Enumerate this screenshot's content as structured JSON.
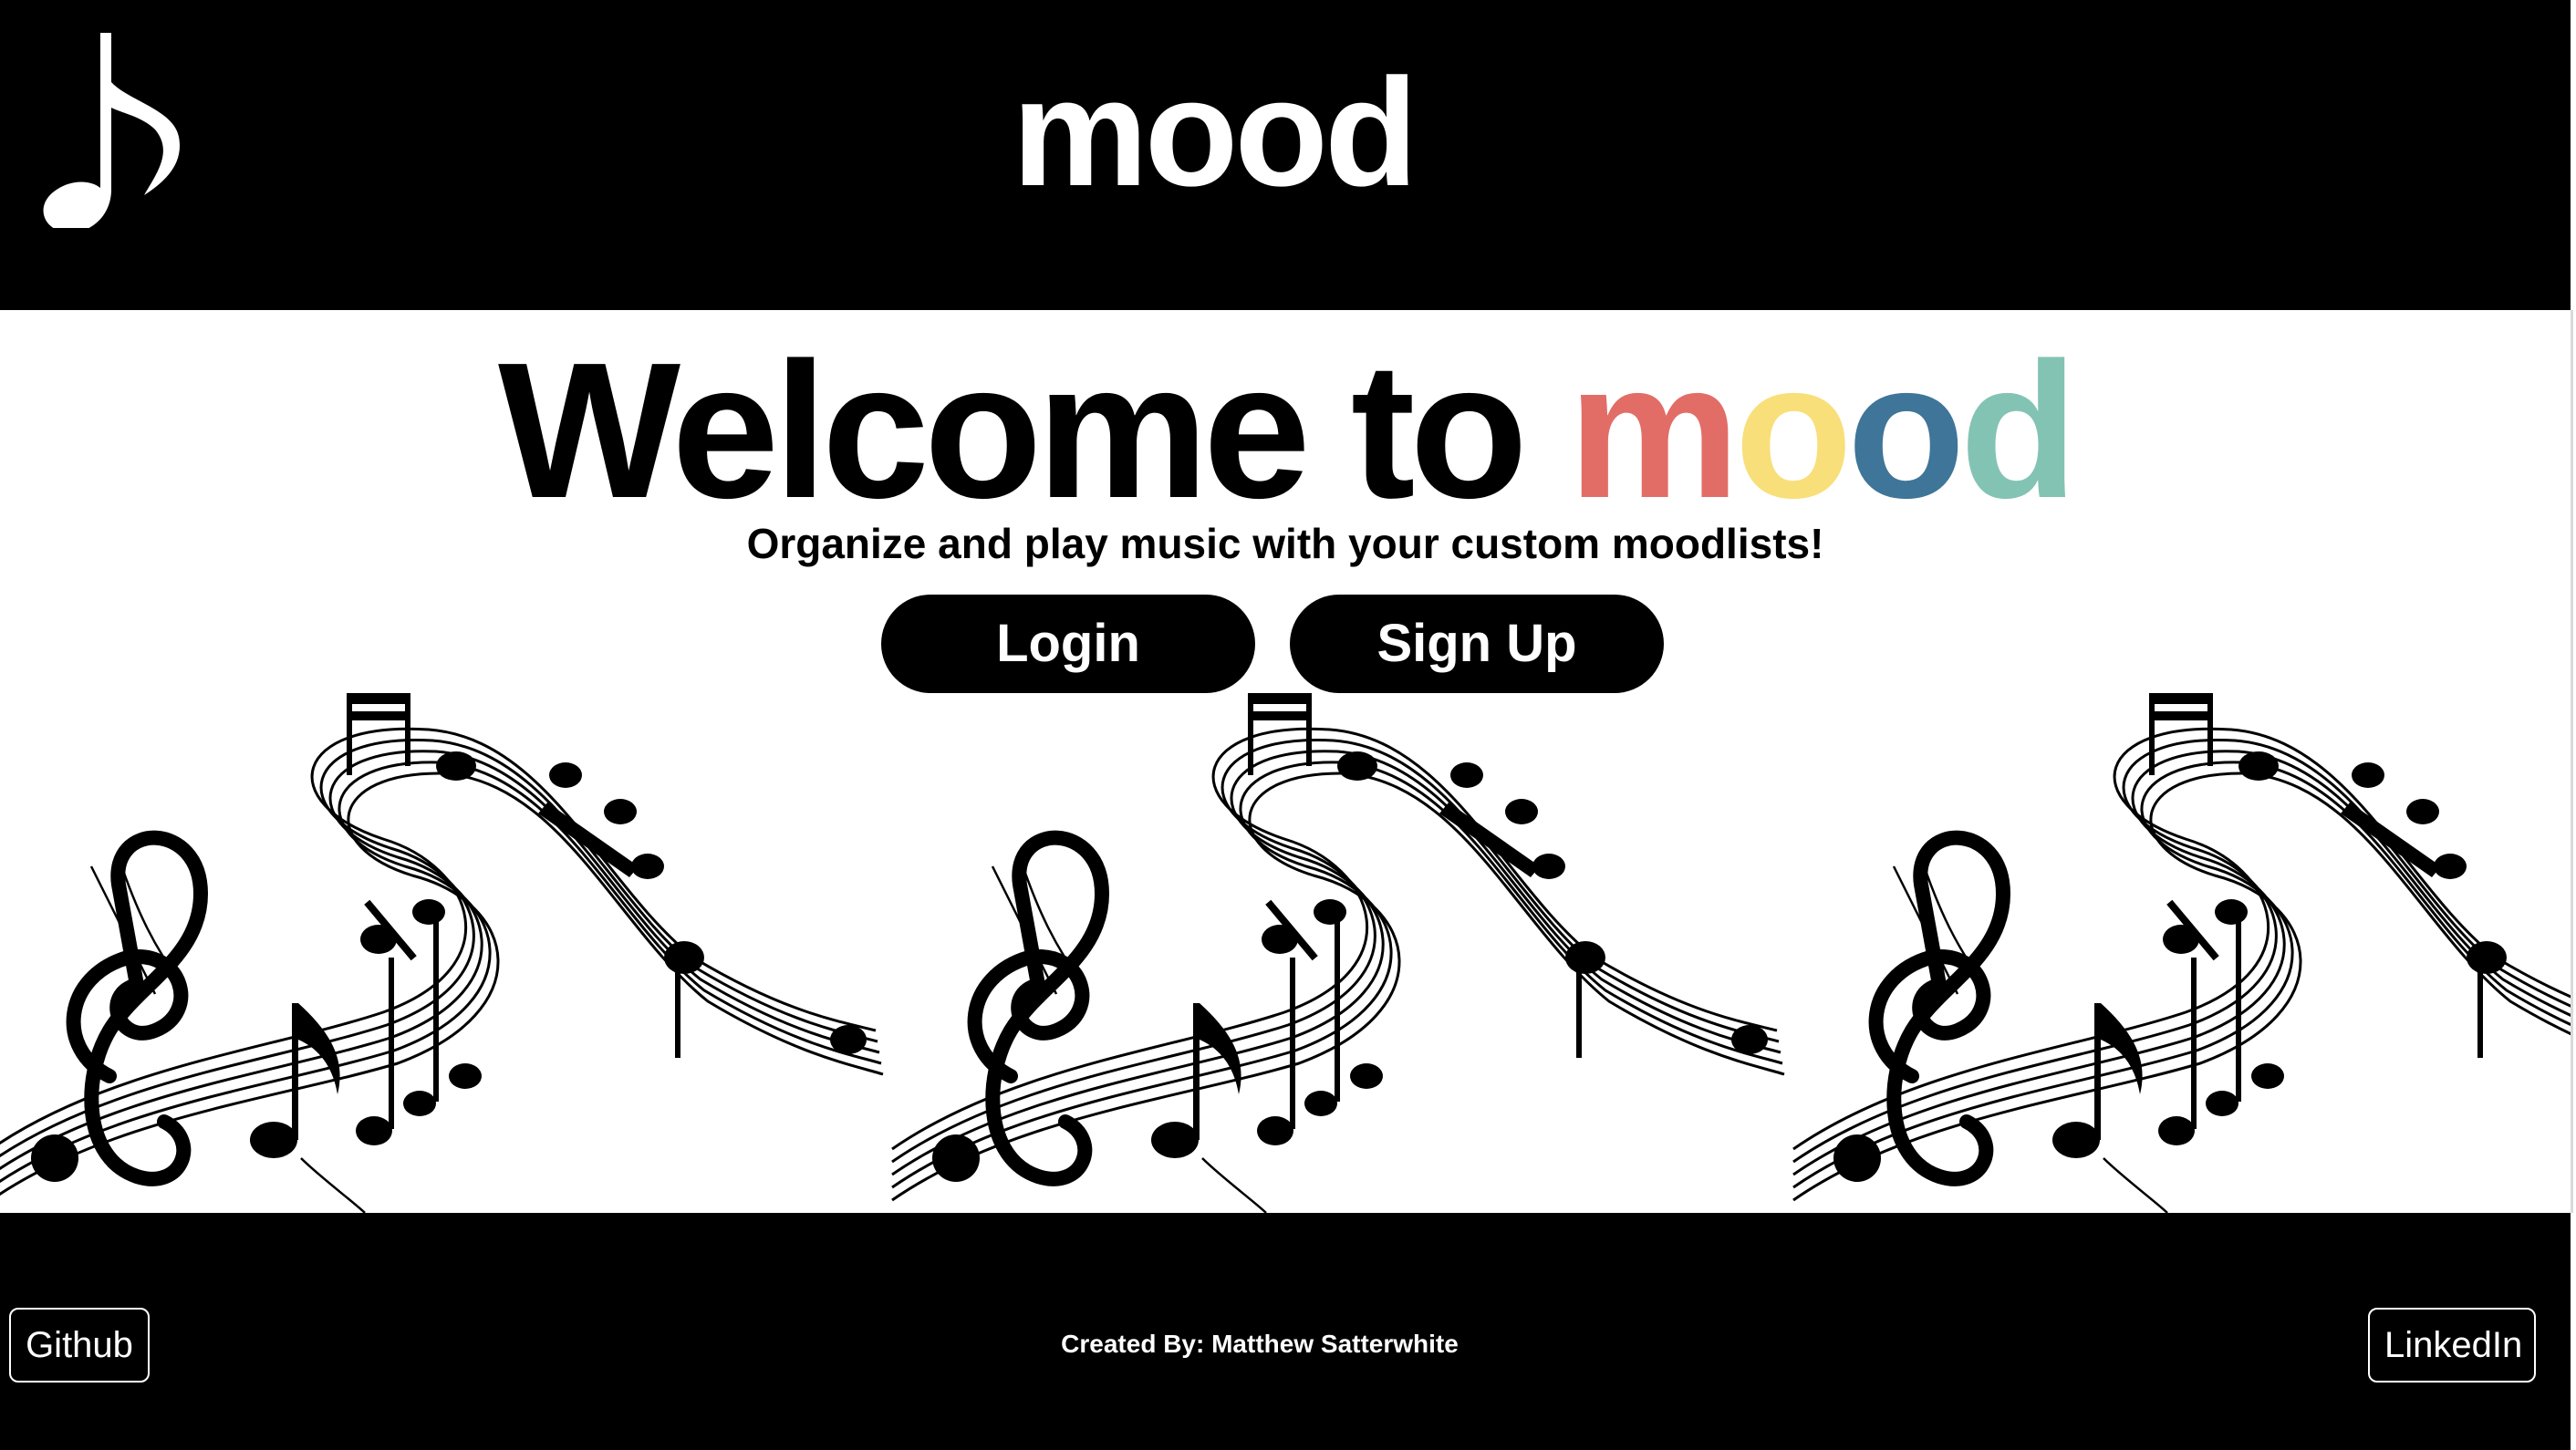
{
  "header": {
    "logo_icon": "music-note-icon",
    "title": "mood"
  },
  "hero": {
    "title_prefix_1": "Welcome",
    "title_prefix_2": "to",
    "title_letters": [
      {
        "char": "m",
        "color": "#E26D67"
      },
      {
        "char": "o",
        "color": "#F8DF7A"
      },
      {
        "char": "o",
        "color": "#3F7598"
      },
      {
        "char": "d",
        "color": "#83C3B4"
      }
    ],
    "subtitle": "Organize and play music with your custom moodlists!",
    "login_label": "Login",
    "signup_label": "Sign Up"
  },
  "banner": {
    "image": "music-staff-banner",
    "repeat": 3
  },
  "footer": {
    "github_label": "Github",
    "credit": "Created By: Matthew Satterwhite",
    "linkedin_label": "LinkedIn"
  },
  "colors": {
    "background": "#FFFFFF",
    "bars": "#000000",
    "text": "#000000",
    "mood_m": "#E26D67",
    "mood_o1": "#F8DF7A",
    "mood_o2": "#3F7598",
    "mood_d": "#83C3B4"
  }
}
